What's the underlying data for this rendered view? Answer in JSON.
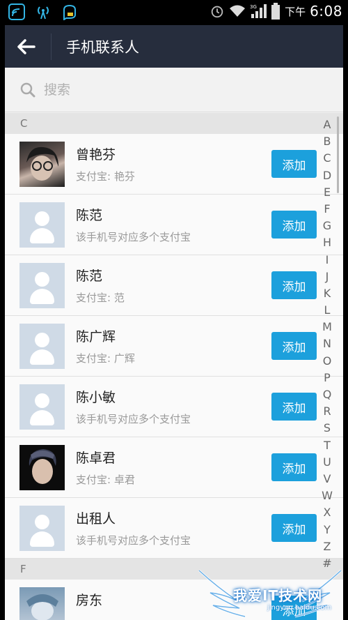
{
  "status_bar": {
    "time": "6:08",
    "ampm": "下午",
    "network": "3G"
  },
  "header": {
    "title": "手机联系人"
  },
  "search": {
    "placeholder": "搜索"
  },
  "sections": [
    {
      "letter": "C",
      "contacts": [
        {
          "name": "曾艳芬",
          "sub": "支付宝: 艳芬",
          "avatar": "photo"
        },
        {
          "name": "陈范",
          "sub": "该手机号对应多个支付宝",
          "avatar": "default"
        },
        {
          "name": "陈范",
          "sub": "支付宝: 范",
          "avatar": "default"
        },
        {
          "name": "陈广辉",
          "sub": "支付宝: 广辉",
          "avatar": "default"
        },
        {
          "name": "陈小敏",
          "sub": "该手机号对应多个支付宝",
          "avatar": "default"
        },
        {
          "name": "陈卓君",
          "sub": "支付宝: 卓君",
          "avatar": "photo"
        },
        {
          "name": "出租人",
          "sub": "该手机号对应多个支付宝",
          "avatar": "default"
        }
      ]
    },
    {
      "letter": "F",
      "contacts": [
        {
          "name": "房东",
          "sub": "",
          "avatar": "photo"
        }
      ]
    }
  ],
  "add_label": "添加",
  "alphabet": [
    "A",
    "B",
    "C",
    "D",
    "E",
    "F",
    "G",
    "H",
    "I",
    "J",
    "K",
    "L",
    "M",
    "N",
    "O",
    "P",
    "Q",
    "R",
    "S",
    "T",
    "U",
    "V",
    "W",
    "X",
    "Y",
    "Z",
    "#"
  ],
  "watermark": {
    "text": "我爱IT技术网",
    "url": "jingyan.baidu.com"
  },
  "colors": {
    "header_bg": "#262d3d",
    "accent": "#1ca0dc"
  }
}
